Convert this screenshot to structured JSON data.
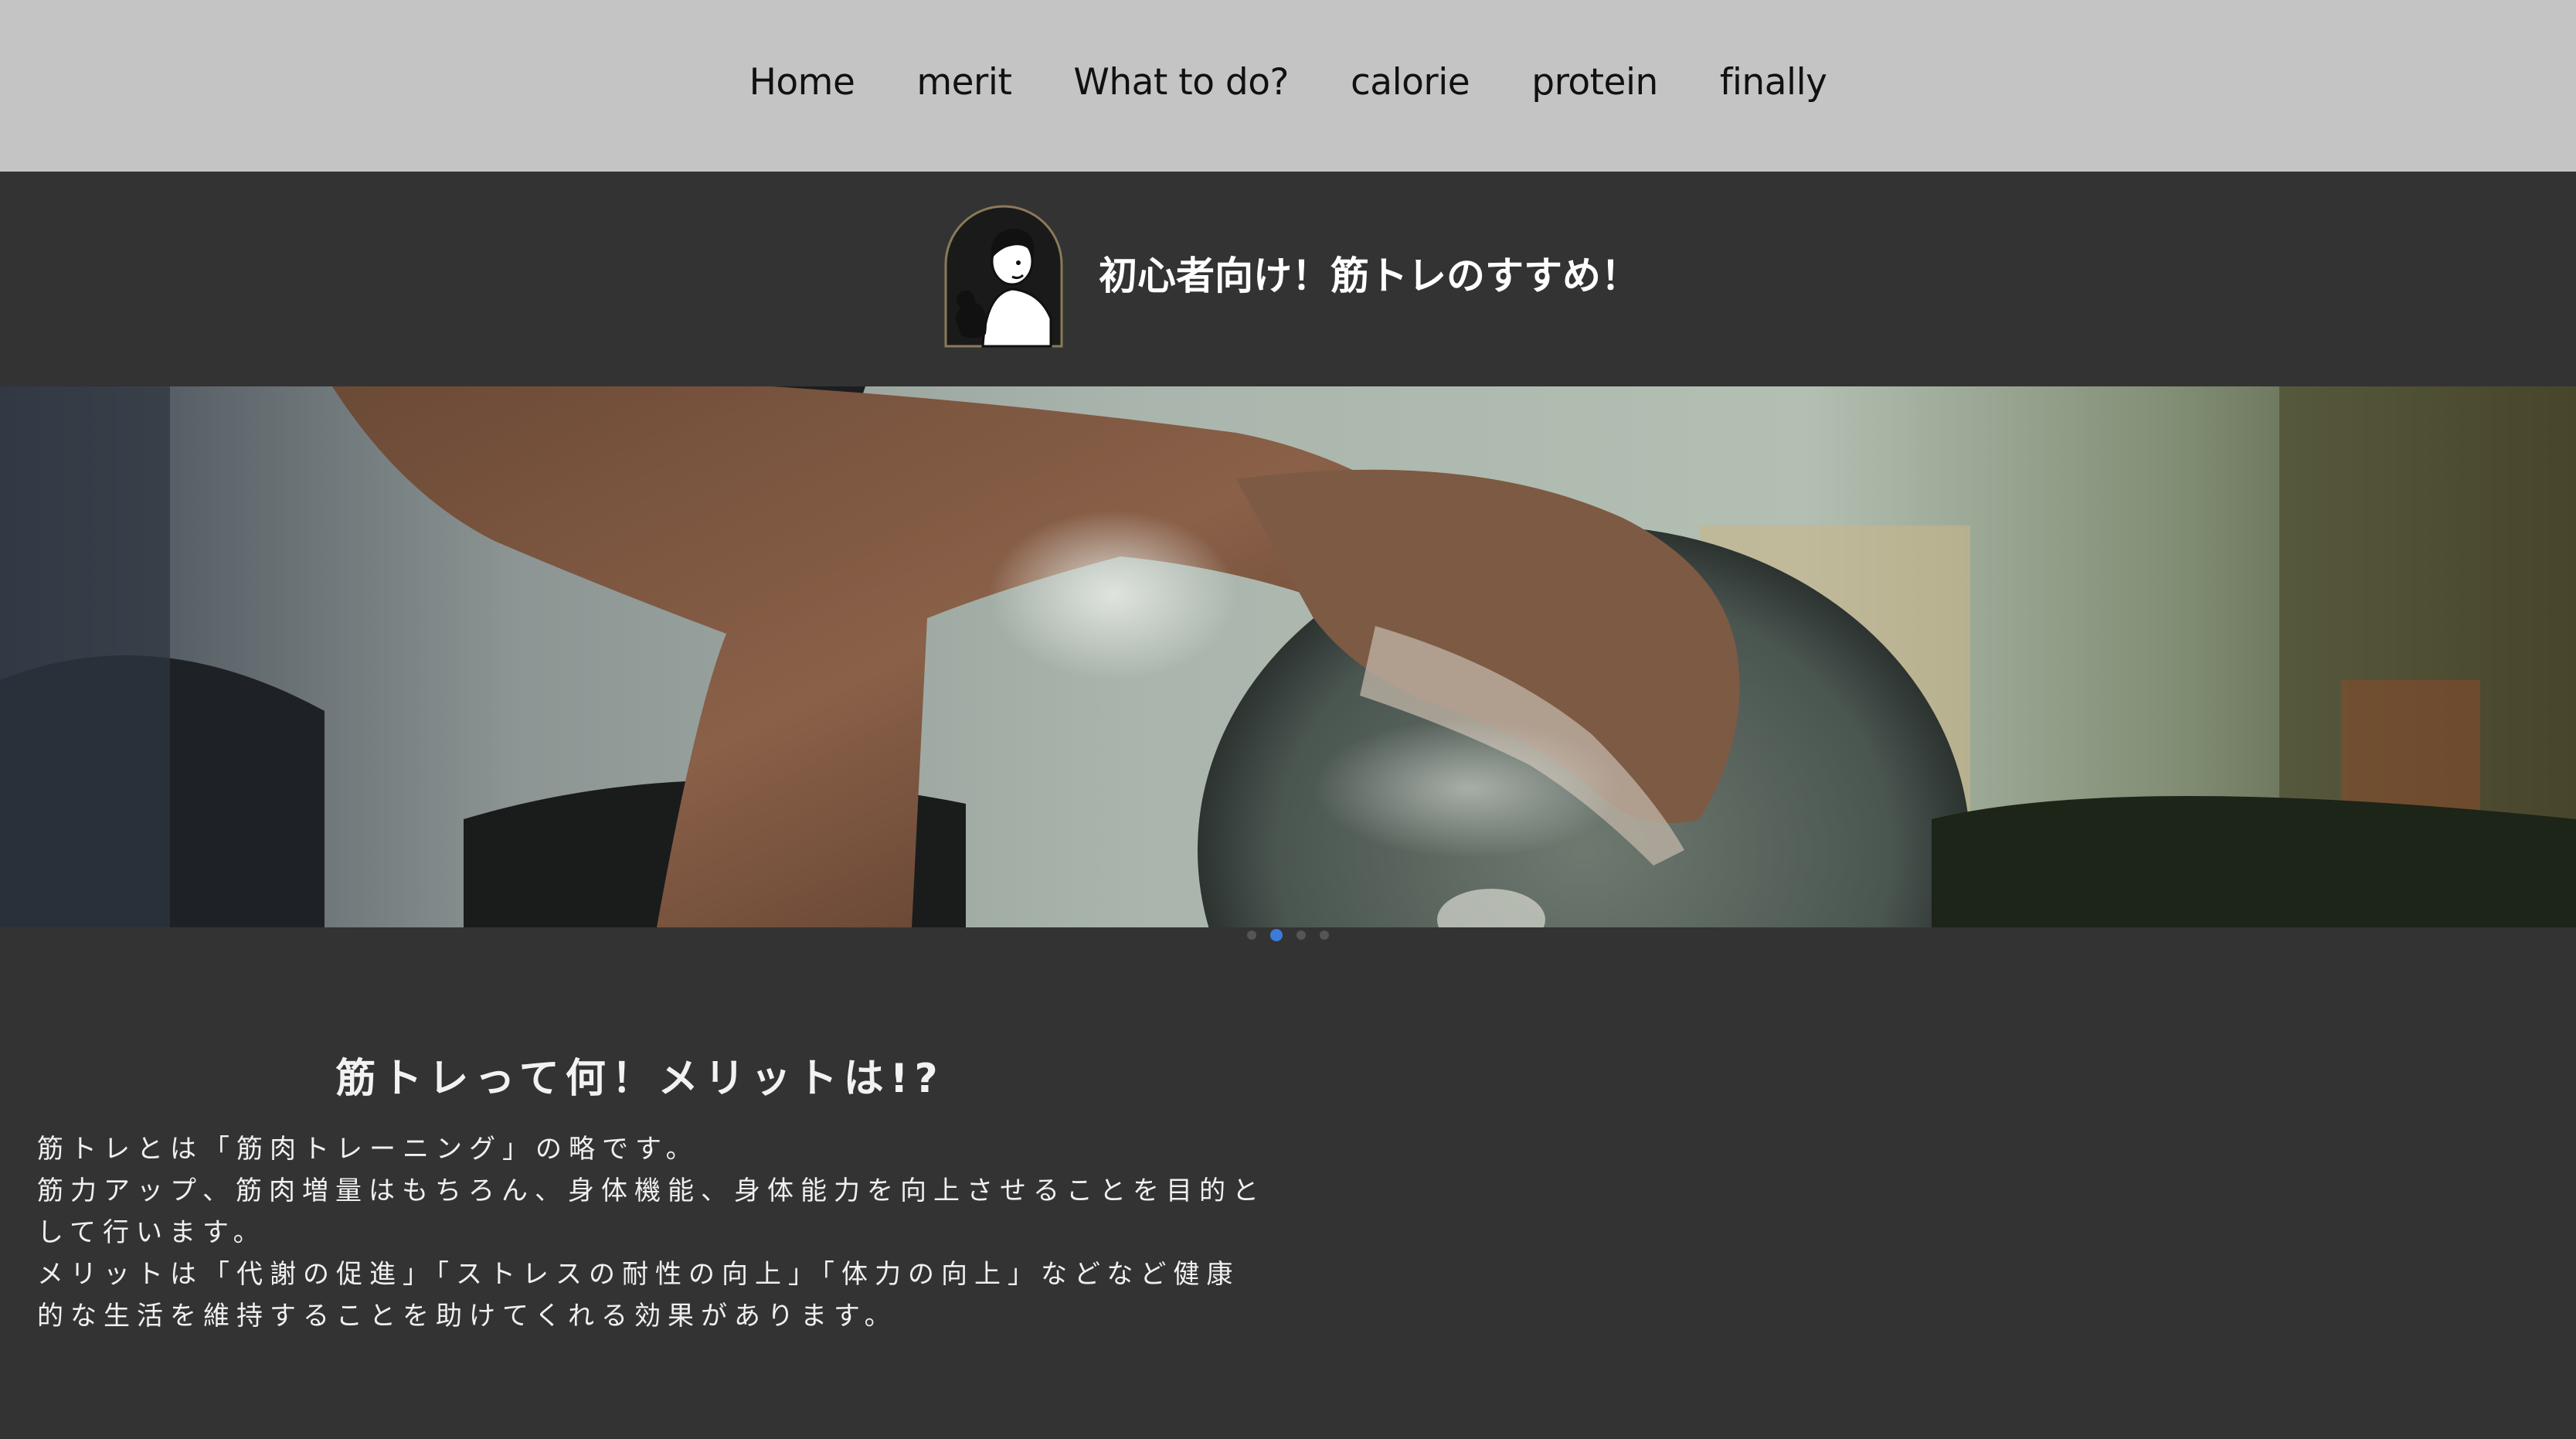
{
  "nav": {
    "items": [
      {
        "label": "Home"
      },
      {
        "label": "merit"
      },
      {
        "label": "What to do?"
      },
      {
        "label": "calorie"
      },
      {
        "label": "protein"
      },
      {
        "label": "finally"
      }
    ]
  },
  "brand": {
    "logo_icon": "man-flexing-logo-icon",
    "title": "初心者向け！筋トレのすすめ！"
  },
  "hero": {
    "image": "hands-chalking-before-lifting-photo",
    "carousel": {
      "count": 4,
      "active_index": 1
    }
  },
  "section": {
    "title": "筋トレって何！メリットは!?",
    "lines": [
      "筋トレとは「筋肉トレーニング」の略です。",
      "筋力アップ、筋肉増量はもちろん、身体機能、身体能力を向上させることを目的と",
      "して行います。",
      "メリットは「代謝の促進」「ストレスの耐性の向上」「体力の向上」などなど健康",
      "的な生活を維持することを助けてくれる効果があります。"
    ]
  },
  "colors": {
    "nav_bg": "#c4c4c4",
    "page_bg": "#333333",
    "carousel_active": "#3b7bd9"
  }
}
